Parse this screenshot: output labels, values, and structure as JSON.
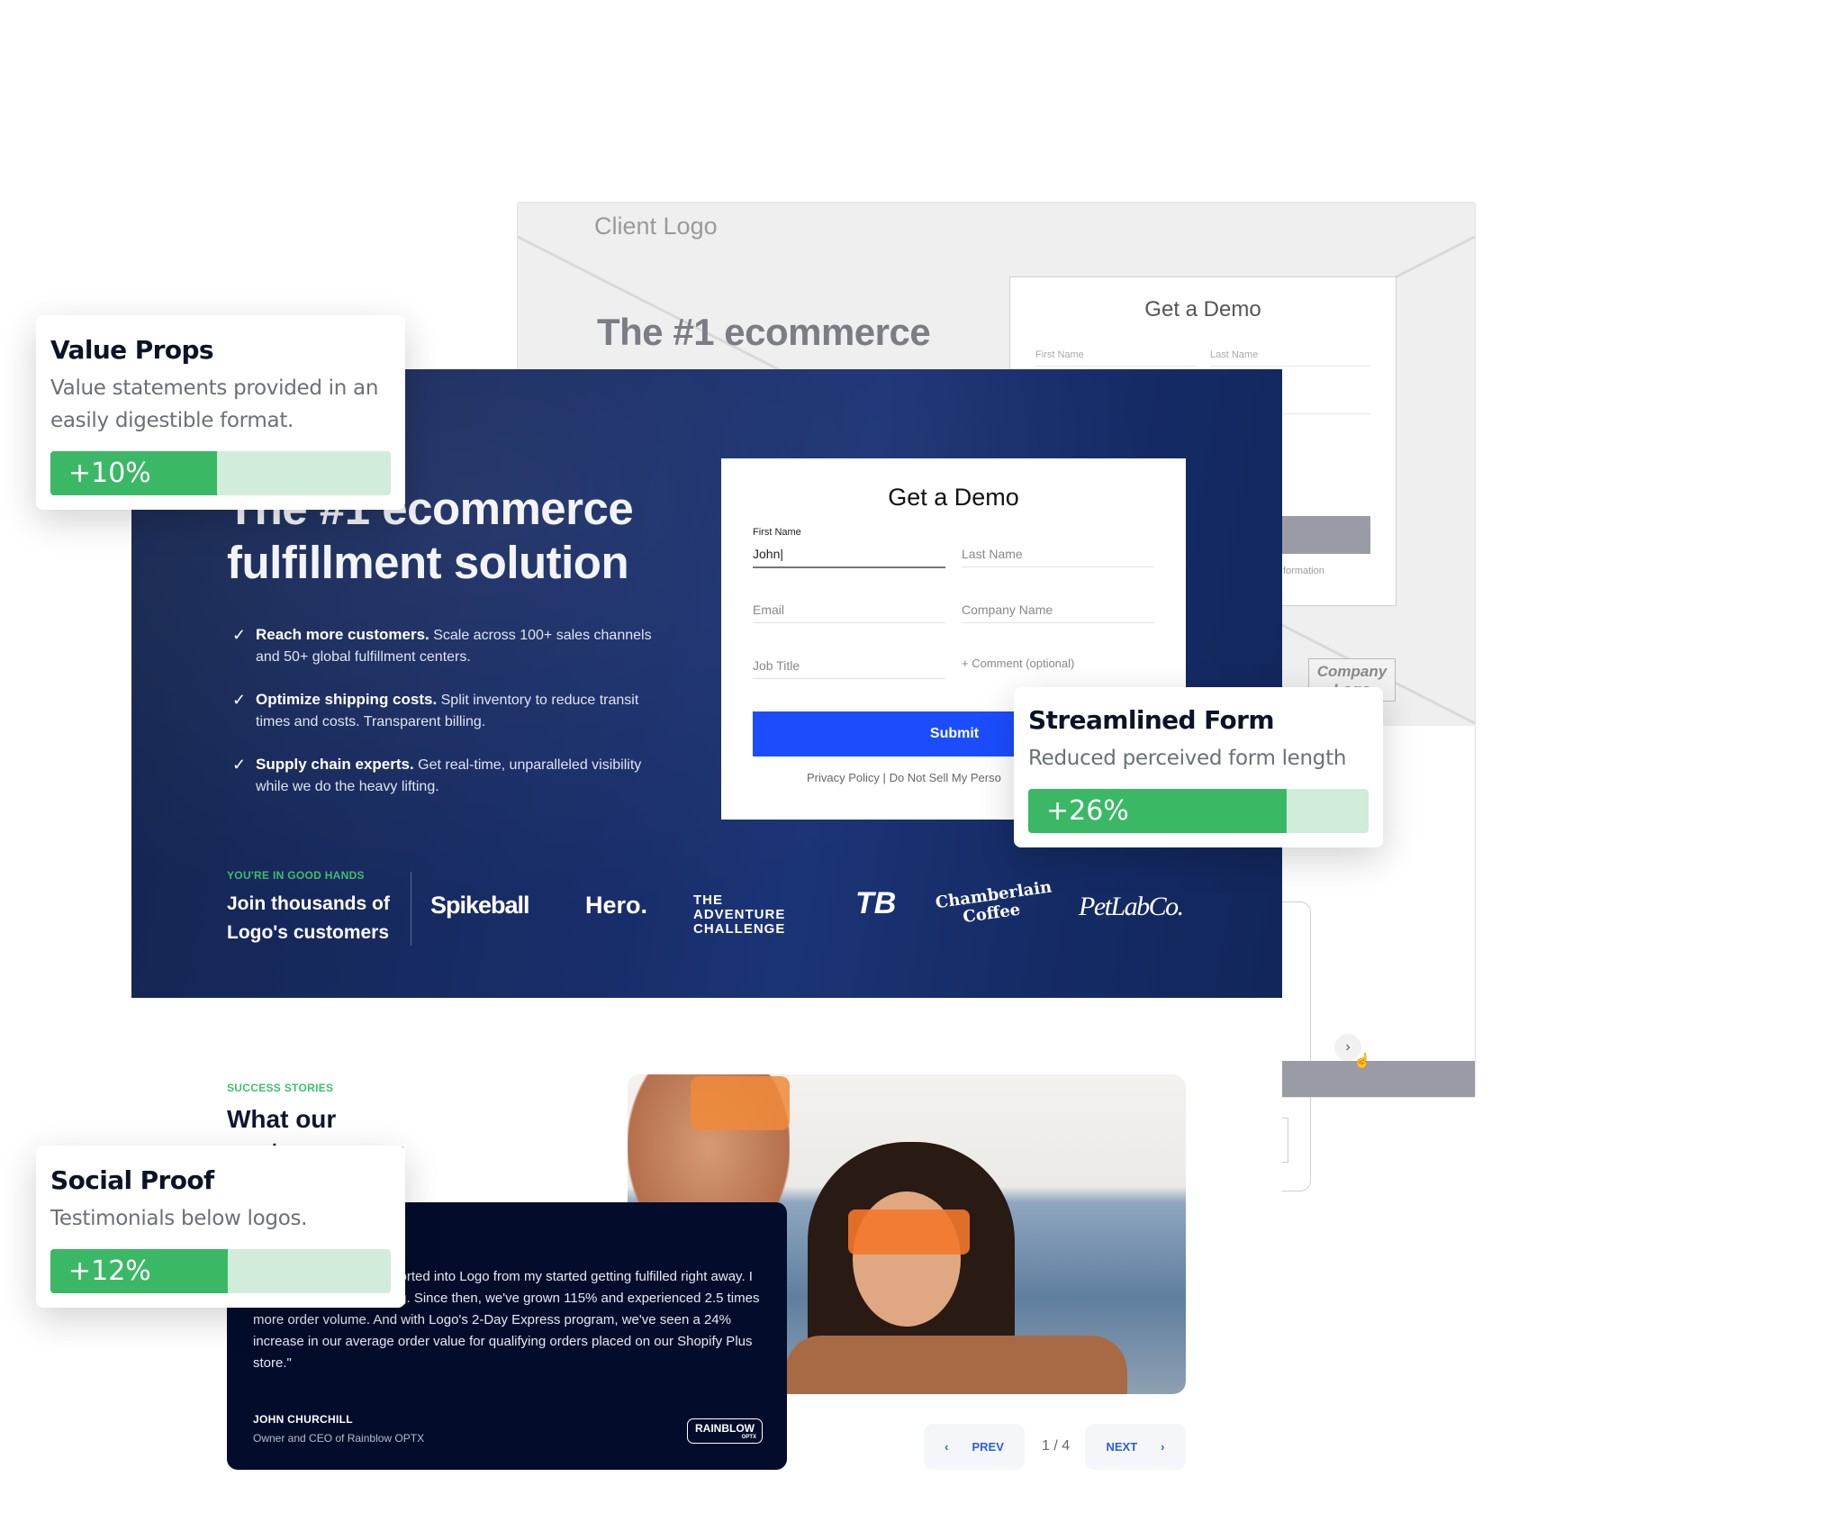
{
  "wireframe": {
    "client_logo": "Client Logo",
    "headline": "The #1 ecommerce",
    "form_title": "Get a Demo",
    "first_name_label": "First Name",
    "last_name_label": "Last Name",
    "fragment_information": "formation",
    "company_logo": "Company Logo",
    "next_icon": "chevron-right"
  },
  "hero": {
    "headline_line1": "The #1 ecommerce",
    "headline_line2": "fulfillment solution",
    "value_props": [
      {
        "bold": "Reach more customers.",
        "text": " Scale across 100+ sales channels and 50+ global fulfillment centers."
      },
      {
        "bold": "Optimize shipping costs.",
        "text": " Split inventory to reduce transit times and costs. Transparent billing."
      },
      {
        "bold": "Supply chain experts.",
        "text": " Get real-time, unparalleled visibility while we do the heavy lifting."
      }
    ],
    "good_hands_eyebrow": "YOU'RE IN GOOD HANDS",
    "join_line1": "Join thousands of",
    "join_line2": "Logo's customers",
    "customer_logos": [
      "Spikeball",
      "Hero.",
      "THE ADVENTURE CHALLENGE",
      "TB",
      "Chamberlain Coffee",
      "PetLabCo."
    ]
  },
  "form": {
    "title": "Get a Demo",
    "first_name_label": "First Name",
    "first_name_value": "John|",
    "last_name_placeholder": "Last Name",
    "email_placeholder": "Email",
    "company_placeholder": "Company Name",
    "job_title_placeholder": "Job Title",
    "comment_placeholder": "+ Comment (optional)",
    "submit_label": "Submit",
    "privacy_link": "Privacy Policy",
    "separator": "|",
    "do_not_sell_link": "Do Not Sell My Perso"
  },
  "testimonials": {
    "eyebrow": "SUCCESS STORIES",
    "heading": "What our customers say",
    "quote": "c — my orders were imported into Logo from my started getting fulfilled right away. I didn't have to do anything. Since then, we've grown 115% and experienced 2.5 times more order volume. And with Logo's 2-Day Express program, we've seen a 24% increase in our average order value for qualifying orders placed on our Shopify Plus store.\"",
    "author_name": "JOHN CHURCHILL",
    "author_role": "Owner and CEO of Rainblow OPTX",
    "brand_logo": "RAINBLOW",
    "brand_logo_sub": "OPTX",
    "prev_label": "PREV",
    "next_label": "NEXT",
    "pager": "1 / 4"
  },
  "annotations": [
    {
      "title": "Value Props",
      "description": "Value statements provided in an easily digestible format.",
      "lift_label": "+10%",
      "bar_fill_fraction": 0.49
    },
    {
      "title": "Streamlined Form",
      "description": "Reduced perceived form length",
      "lift_label": "+26%",
      "bar_fill_fraction": 0.76
    },
    {
      "title": "Social Proof",
      "description": "Testimonials below logos.",
      "lift_label": "+12%",
      "bar_fill_fraction": 0.52
    }
  ],
  "colors": {
    "accent_green": "#3bb866",
    "bar_track": "#d2ecdb",
    "submit_blue": "#1b4dff",
    "hero_navy": "#182d6a",
    "testimonial_navy": "#030d2b"
  }
}
